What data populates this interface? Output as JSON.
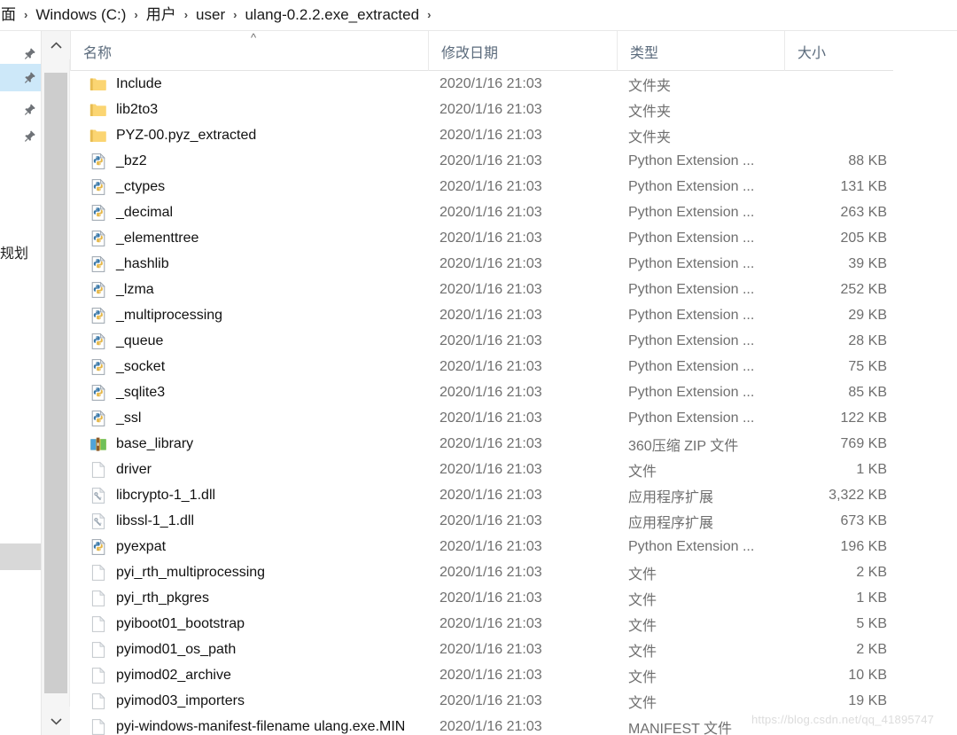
{
  "breadcrumb": {
    "leading_clipped": "面",
    "separator": "›",
    "items": [
      "Windows (C:)",
      "用户",
      "user",
      "ulang-0.2.2.exe_extracted"
    ]
  },
  "nav_pane": {
    "pin_icon": "pin-icon",
    "partial_label": "规划",
    "pin_rows": 4,
    "selected_index": 1
  },
  "scrollbar": {
    "up_arrow": "chevron-up-icon",
    "down_arrow": "chevron-down-icon"
  },
  "columns": [
    {
      "key": "name",
      "label": "名称",
      "sorted": true,
      "sort_caret": "^"
    },
    {
      "key": "date",
      "label": "修改日期",
      "sorted": false
    },
    {
      "key": "type",
      "label": "类型",
      "sorted": false
    },
    {
      "key": "size",
      "label": "大小",
      "sorted": false
    }
  ],
  "rows": [
    {
      "name": "Include",
      "date": "2020/1/16 21:03",
      "type": "文件夹",
      "size": "",
      "icon": "folder-icon"
    },
    {
      "name": "lib2to3",
      "date": "2020/1/16 21:03",
      "type": "文件夹",
      "size": "",
      "icon": "folder-icon"
    },
    {
      "name": "PYZ-00.pyz_extracted",
      "date": "2020/1/16 21:03",
      "type": "文件夹",
      "size": "",
      "icon": "folder-icon"
    },
    {
      "name": "_bz2",
      "date": "2020/1/16 21:03",
      "type": "Python Extension ...",
      "size": "88 KB",
      "icon": "python-extension-icon"
    },
    {
      "name": "_ctypes",
      "date": "2020/1/16 21:03",
      "type": "Python Extension ...",
      "size": "131 KB",
      "icon": "python-extension-icon"
    },
    {
      "name": "_decimal",
      "date": "2020/1/16 21:03",
      "type": "Python Extension ...",
      "size": "263 KB",
      "icon": "python-extension-icon"
    },
    {
      "name": "_elementtree",
      "date": "2020/1/16 21:03",
      "type": "Python Extension ...",
      "size": "205 KB",
      "icon": "python-extension-icon"
    },
    {
      "name": "_hashlib",
      "date": "2020/1/16 21:03",
      "type": "Python Extension ...",
      "size": "39 KB",
      "icon": "python-extension-icon"
    },
    {
      "name": "_lzma",
      "date": "2020/1/16 21:03",
      "type": "Python Extension ...",
      "size": "252 KB",
      "icon": "python-extension-icon"
    },
    {
      "name": "_multiprocessing",
      "date": "2020/1/16 21:03",
      "type": "Python Extension ...",
      "size": "29 KB",
      "icon": "python-extension-icon"
    },
    {
      "name": "_queue",
      "date": "2020/1/16 21:03",
      "type": "Python Extension ...",
      "size": "28 KB",
      "icon": "python-extension-icon"
    },
    {
      "name": "_socket",
      "date": "2020/1/16 21:03",
      "type": "Python Extension ...",
      "size": "75 KB",
      "icon": "python-extension-icon"
    },
    {
      "name": "_sqlite3",
      "date": "2020/1/16 21:03",
      "type": "Python Extension ...",
      "size": "85 KB",
      "icon": "python-extension-icon"
    },
    {
      "name": "_ssl",
      "date": "2020/1/16 21:03",
      "type": "Python Extension ...",
      "size": "122 KB",
      "icon": "python-extension-icon"
    },
    {
      "name": "base_library",
      "date": "2020/1/16 21:03",
      "type": "360压缩 ZIP 文件",
      "size": "769 KB",
      "icon": "zip-archive-icon"
    },
    {
      "name": "driver",
      "date": "2020/1/16 21:03",
      "type": "文件",
      "size": "1 KB",
      "icon": "blank-file-icon"
    },
    {
      "name": "libcrypto-1_1.dll",
      "date": "2020/1/16 21:03",
      "type": "应用程序扩展",
      "size": "3,322 KB",
      "icon": "dll-icon"
    },
    {
      "name": "libssl-1_1.dll",
      "date": "2020/1/16 21:03",
      "type": "应用程序扩展",
      "size": "673 KB",
      "icon": "dll-icon"
    },
    {
      "name": "pyexpat",
      "date": "2020/1/16 21:03",
      "type": "Python Extension ...",
      "size": "196 KB",
      "icon": "python-extension-icon"
    },
    {
      "name": "pyi_rth_multiprocessing",
      "date": "2020/1/16 21:03",
      "type": "文件",
      "size": "2 KB",
      "icon": "blank-file-icon"
    },
    {
      "name": "pyi_rth_pkgres",
      "date": "2020/1/16 21:03",
      "type": "文件",
      "size": "1 KB",
      "icon": "blank-file-icon"
    },
    {
      "name": "pyiboot01_bootstrap",
      "date": "2020/1/16 21:03",
      "type": "文件",
      "size": "5 KB",
      "icon": "blank-file-icon"
    },
    {
      "name": "pyimod01_os_path",
      "date": "2020/1/16 21:03",
      "type": "文件",
      "size": "2 KB",
      "icon": "blank-file-icon"
    },
    {
      "name": "pyimod02_archive",
      "date": "2020/1/16 21:03",
      "type": "文件",
      "size": "10 KB",
      "icon": "blank-file-icon"
    },
    {
      "name": "pyimod03_importers",
      "date": "2020/1/16 21:03",
      "type": "文件",
      "size": "19 KB",
      "icon": "blank-file-icon"
    },
    {
      "name": "pyi-windows-manifest-filename ulang.exe.MIN",
      "date": "2020/1/16 21:03",
      "type": "MANIFEST 文件",
      "size": "",
      "icon": "blank-file-icon"
    }
  ],
  "watermark": "https://blog.csdn.net/qq_41895747"
}
